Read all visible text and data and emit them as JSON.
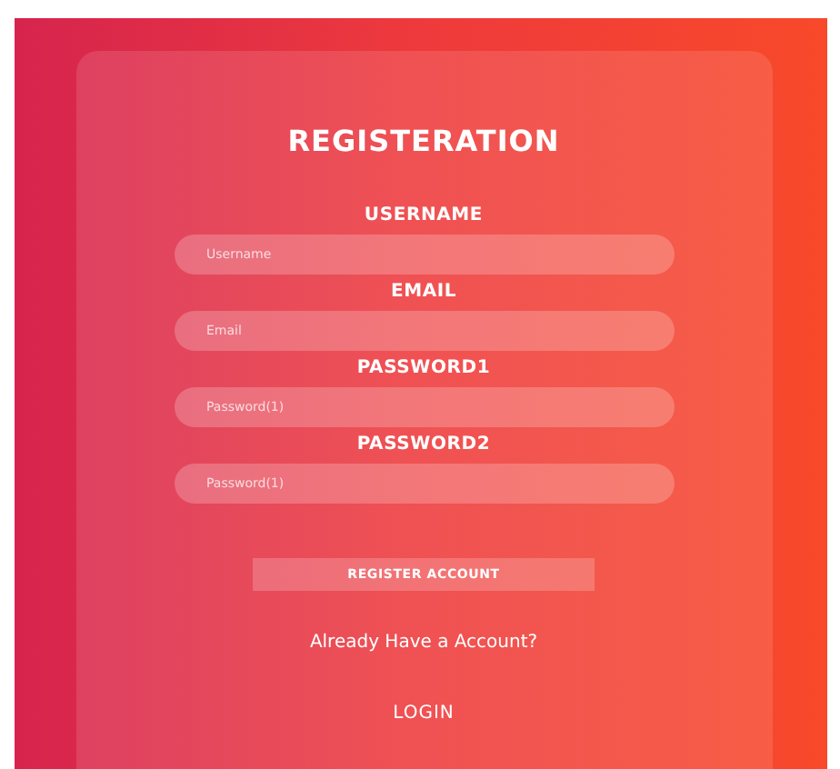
{
  "title": "REGISTERATION",
  "fields": [
    {
      "label": "USERNAME",
      "placeholder": "Username"
    },
    {
      "label": "EMAIL",
      "placeholder": "Email"
    },
    {
      "label": "PASSWORD1",
      "placeholder": "Password(1)"
    },
    {
      "label": "PASSWORD2",
      "placeholder": "Password(1)"
    }
  ],
  "submit": "REGISTER ACCOUNT",
  "prompt": "Already Have a Account?",
  "login": "LOGIN"
}
